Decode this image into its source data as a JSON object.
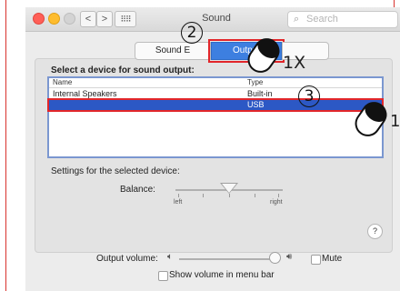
{
  "window": {
    "title": "Sound",
    "search_placeholder": "Search",
    "nav_back": "<",
    "nav_forward": ">",
    "nav_grid": "⠿⠿"
  },
  "tabs": [
    {
      "label": "Sound E",
      "selected": false
    },
    {
      "label": "Output",
      "selected": true
    },
    {
      "label": "",
      "selected": false
    }
  ],
  "output": {
    "select_label": "Select a device for sound output:",
    "columns": [
      "Name",
      "Type"
    ],
    "devices": [
      {
        "name": "Internal Speakers",
        "type": "Built-in",
        "selected": false
      },
      {
        "name": "",
        "type": "USB",
        "selected": true
      }
    ],
    "settings_label": "Settings for the selected device:",
    "balance_label": "Balance:",
    "balance_left": "left",
    "balance_right": "right",
    "balance_value": 0.5
  },
  "bottom": {
    "output_volume_label": "Output volume:",
    "volume_value": 0.98,
    "mute_label": "Mute",
    "mute_checked": false,
    "show_volume_label": "Show volume in menu bar",
    "show_volume_checked": false,
    "help": "?"
  },
  "annotations": {
    "step2": "2",
    "step3": "3",
    "click_once_top": "1X",
    "click_once_right": "1"
  },
  "colors": {
    "selection_blue": "#2c58c5",
    "tab_blue": "#3d7fe0",
    "annotation_red": "#e2262a"
  }
}
